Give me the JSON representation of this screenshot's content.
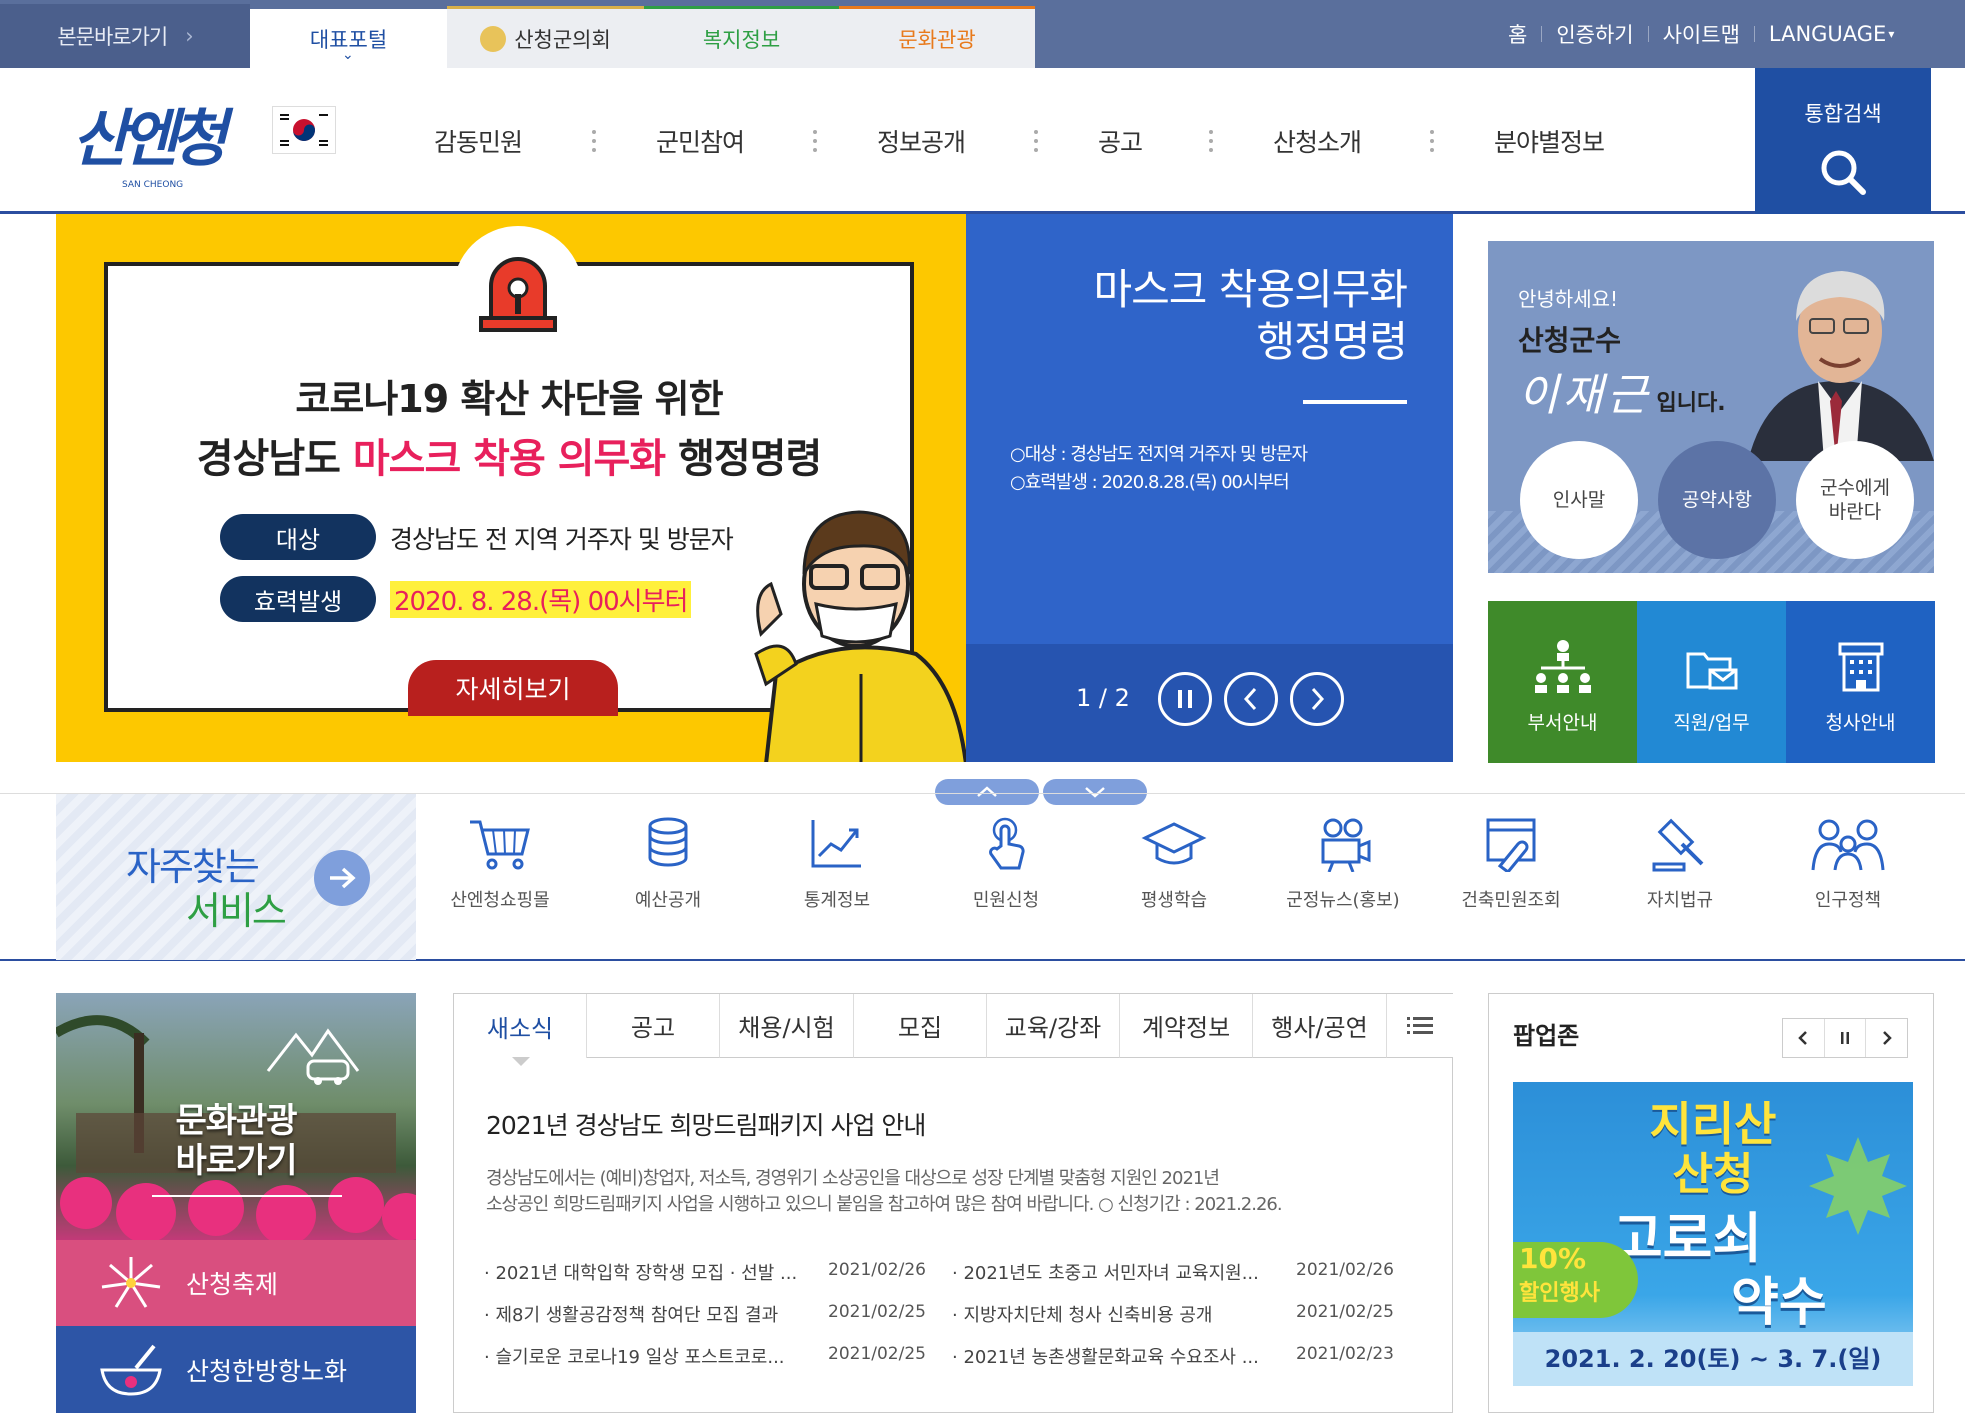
{
  "topbar": {
    "skip_link": "본문바로가기",
    "portal_tabs": [
      {
        "label": "대표포털",
        "color": "#5a6f9c",
        "active": true
      },
      {
        "label": "산청군의회",
        "color": "#d8b04a"
      },
      {
        "label": "복지정보",
        "color": "#2e9f44"
      },
      {
        "label": "문화관광",
        "color": "#e87a1c"
      }
    ],
    "util_links": [
      "홈",
      "인증하기",
      "사이트맵",
      "LANGUAGE"
    ]
  },
  "header": {
    "logo_text": "산엔청",
    "logo_sub": "SAN CHEONG",
    "menu": [
      "감동민원",
      "군민참여",
      "정보공개",
      "공고",
      "산청소개",
      "분야별정보"
    ],
    "search_label": "통합검색"
  },
  "main_banner": {
    "headline1": "코로나19 확산 차단을 위한",
    "headline2_a": "경상남도",
    "headline2_b": "마스크 착용 의무화",
    "headline2_c": "행정명령",
    "target_label": "대상",
    "target_text": "경상남도 전 지역 거주자 및 방문자",
    "effective_label": "효력발생",
    "effective_text": "2020. 8. 28.(목) 00시부터",
    "detail_button": "자세히보기"
  },
  "blue_banner": {
    "title_line1": "마스크 착용의무화",
    "title_line2": "행정명령",
    "info_line1": "○대상 : 경상남도 전지역 거주자 및 방문자",
    "info_line2": "○효력발생 : 2020.8.28.(목) 00시부터",
    "page_indicator": "1 / 2"
  },
  "mayor": {
    "greeting": "안녕하세요!",
    "title": "산청군수",
    "name": "이재근",
    "suffix": "입니다.",
    "buttons": [
      "인사말",
      "공약사항",
      "군수에게 바란다"
    ]
  },
  "quick_links": [
    {
      "label": "부서안내",
      "color": "#3f8a2a"
    },
    {
      "label": "직원/업무",
      "color": "#2289d4"
    },
    {
      "label": "청사안내",
      "color": "#1f62c2"
    }
  ],
  "frequent_services": {
    "title_line1": "자주찾는",
    "title_line2": "서비스",
    "items": [
      "산엔청쇼핑몰",
      "예산공개",
      "통계정보",
      "민원신청",
      "평생학습",
      "군정뉴스(홍보)",
      "건축민원조회",
      "자치법규",
      "인구정책"
    ]
  },
  "culture": {
    "label_line1": "문화관광",
    "label_line2": "바로가기",
    "festival": "산청축제",
    "herbal": "산청한방항노화"
  },
  "news": {
    "tabs": [
      "새소식",
      "공고",
      "채용/시험",
      "모집",
      "교육/강좌",
      "계약정보",
      "행사/공연"
    ],
    "featured_title": "2021년 경상남도 희망드림패키지 사업 안내",
    "featured_body1": "경상남도에서는 (예비)창업자, 저소득, 경영위기 소상공인을 대상으로 성장 단계별 맞춤형 지원인 2021년",
    "featured_body2": "소상공인 희망드림패키지 사업을 시행하고 있으니 붙임을 참고하여 많은 참여 바랍니다. ○ 신청기간 : 2021.2.26.",
    "items": [
      {
        "title": "· 2021년 대학입학 장학생 모집 · 선발 ...",
        "date": "2021/02/26"
      },
      {
        "title": "· 2021년도 초중고 서민자녀 교육지원...",
        "date": "2021/02/26"
      },
      {
        "title": "· 제8기 생활공감정책 참여단 모집 결과",
        "date": "2021/02/25"
      },
      {
        "title": "· 지방자치단체 청사 신축비용 공개",
        "date": "2021/02/25"
      },
      {
        "title": "· 슬기로운 코로나19 일상 포스트코로...",
        "date": "2021/02/25"
      },
      {
        "title": "· 2021년 농촌생활문화교육 수요조사 ...",
        "date": "2021/02/23"
      }
    ]
  },
  "popup": {
    "title": "팝업존",
    "banner_line1": "지리산",
    "banner_line2": "산청",
    "banner_line3": "고로쇠",
    "banner_line4": "약수",
    "badge_pct": "10%",
    "badge_text": "할인행사",
    "date_range": "2021. 2. 20(토) ~ 3. 7.(일)"
  }
}
